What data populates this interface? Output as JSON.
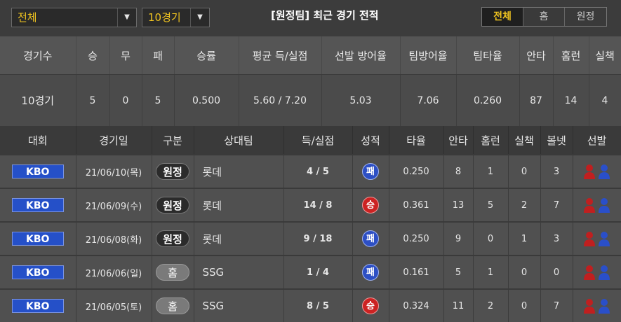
{
  "filters": {
    "type_select": "전체",
    "count_select": "10경기"
  },
  "title": "[원정팀] 최근 경기 전적",
  "toggle": {
    "items": [
      "전체",
      "홈",
      "원정"
    ],
    "active": "전체"
  },
  "summary": {
    "headers": [
      "경기수",
      "승",
      "무",
      "패",
      "승률",
      "평균 득/실점",
      "선발 방어율",
      "팀방어율",
      "팀타율",
      "안타",
      "홈런",
      "실책"
    ],
    "values": [
      "10경기",
      "5",
      "0",
      "5",
      "0.500",
      "5.60 / 7.20",
      "5.03",
      "7.06",
      "0.260",
      "87",
      "14",
      "4"
    ]
  },
  "games": {
    "headers": [
      "대회",
      "경기일",
      "구분",
      "상대팀",
      "득/실점",
      "성적",
      "타율",
      "안타",
      "홈런",
      "실책",
      "볼넷",
      "선발"
    ],
    "rows": [
      {
        "league": "KBO",
        "date": "21/06/10(목)",
        "side": "원정",
        "side_type": "away",
        "opponent": "롯데",
        "score": "4 / 5",
        "result": "패",
        "result_type": "lose",
        "avg": "0.250",
        "hits": "8",
        "hr": "1",
        "errors": "0",
        "walks": "3"
      },
      {
        "league": "KBO",
        "date": "21/06/09(수)",
        "side": "원정",
        "side_type": "away",
        "opponent": "롯데",
        "score": "14 / 8",
        "result": "승",
        "result_type": "win",
        "avg": "0.361",
        "hits": "13",
        "hr": "5",
        "errors": "2",
        "walks": "7"
      },
      {
        "league": "KBO",
        "date": "21/06/08(화)",
        "side": "원정",
        "side_type": "away",
        "opponent": "롯데",
        "score": "9 / 18",
        "result": "패",
        "result_type": "lose",
        "avg": "0.250",
        "hits": "9",
        "hr": "0",
        "errors": "1",
        "walks": "3"
      },
      {
        "league": "KBO",
        "date": "21/06/06(일)",
        "side": "홈",
        "side_type": "home",
        "opponent": "SSG",
        "score": "1 / 4",
        "result": "패",
        "result_type": "lose",
        "avg": "0.161",
        "hits": "5",
        "hr": "1",
        "errors": "0",
        "walks": "0"
      },
      {
        "league": "KBO",
        "date": "21/06/05(토)",
        "side": "홈",
        "side_type": "home",
        "opponent": "SSG",
        "score": "8 / 5",
        "result": "승",
        "result_type": "win",
        "avg": "0.324",
        "hits": "11",
        "hr": "2",
        "errors": "0",
        "walks": "7"
      }
    ]
  },
  "colors": {
    "accent": "#f0c420",
    "kbo": "#2550c8",
    "win": "#cc2222",
    "lose": "#2d4fc4",
    "pitcher_red": "#c01f1f",
    "pitcher_blue": "#2a4fc9"
  },
  "icons": {
    "pitchers": [
      "red-person-icon",
      "blue-person-icon"
    ]
  }
}
